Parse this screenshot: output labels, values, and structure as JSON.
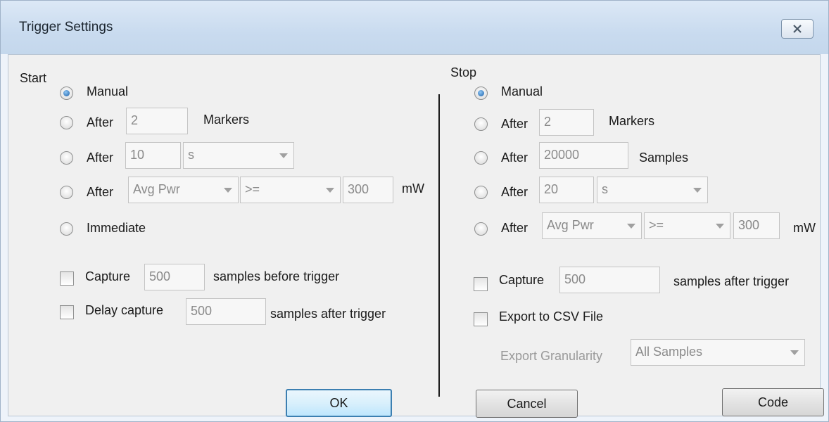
{
  "window": {
    "title": "Trigger Settings"
  },
  "start": {
    "heading": "Start",
    "manual": "Manual",
    "after_markers": {
      "label": "After",
      "value": "2",
      "unit": "Markers"
    },
    "after_time": {
      "label": "After",
      "value": "10",
      "unit_selected": "s"
    },
    "after_power": {
      "label": "After",
      "metric": "Avg Pwr",
      "operator": ">=",
      "value": "300",
      "unit": "mW"
    },
    "immediate": "Immediate",
    "capture": {
      "label": "Capture",
      "value": "500",
      "suffix": "samples before trigger"
    },
    "delay_capture": {
      "label": "Delay capture",
      "value": "500",
      "suffix": "samples after trigger"
    }
  },
  "stop": {
    "heading": "Stop",
    "manual": "Manual",
    "after_markers": {
      "label": "After",
      "value": "2",
      "unit": "Markers"
    },
    "after_samples": {
      "label": "After",
      "value": "20000",
      "unit": "Samples"
    },
    "after_time": {
      "label": "After",
      "value": "20",
      "unit_selected": "s"
    },
    "after_power": {
      "label": "After",
      "metric": "Avg Pwr",
      "operator": ">=",
      "value": "300",
      "unit": "mW"
    },
    "capture": {
      "label": "Capture",
      "value": "500",
      "suffix": "samples after trigger"
    },
    "export_csv": "Export to CSV File",
    "export_granularity": {
      "label": "Export Granularity",
      "selected": "All Samples"
    }
  },
  "buttons": {
    "ok": "OK",
    "cancel": "Cancel",
    "code": "Code"
  },
  "icons": {
    "close": "close-icon"
  },
  "colors": {
    "default_button_border": "#3c7fb1",
    "title_bar": "#c9dbef"
  }
}
